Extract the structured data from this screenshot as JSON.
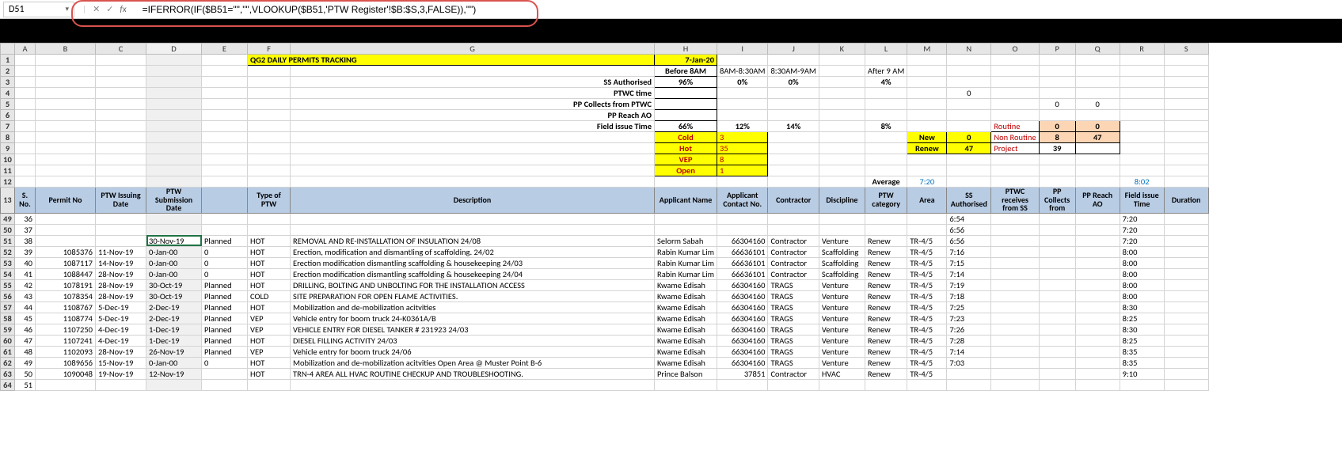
{
  "formulaBar": {
    "cellRef": "D51",
    "formula": "=IFERROR(IF($B51=\"\",\"\",VLOOKUP($B51,'PTW Register'!$B:$S,3,FALSE)),\"\")"
  },
  "top": {
    "title": "QG2 DAILY PERMITS TRACKING",
    "date": "7-Jan-20",
    "timeBuckets": [
      "Before 8AM",
      "8AM-8:30AM",
      "8:30AM-9AM",
      "After 9 AM"
    ],
    "rowLabels": [
      "SS Authorised",
      "PTWC time",
      "PP Collects from PTWC",
      "PP Reach AO",
      "Field issue Time"
    ],
    "ssAuth": [
      "96%",
      "0%",
      "0%",
      "4%"
    ],
    "ptwcCount": "0",
    "ppColl": [
      "0",
      "0"
    ],
    "fieldIssue": [
      "66%",
      "12%",
      "14%",
      "8%"
    ],
    "cats": [
      {
        "name": "Cold",
        "val": "3"
      },
      {
        "name": "Hot",
        "val": "35"
      },
      {
        "name": "VEP",
        "val": "8"
      },
      {
        "name": "Open",
        "val": "1"
      }
    ],
    "nr": [
      {
        "name": "New",
        "val": "0"
      },
      {
        "name": "Renew",
        "val": "47"
      }
    ],
    "statusLabels": [
      "Routine",
      "Non Routine",
      "Project"
    ],
    "statusVals": [
      [
        "0",
        "0"
      ],
      [
        "8",
        "47"
      ],
      [
        "39",
        ""
      ]
    ],
    "avgLabel": "Average",
    "avgVals": [
      "7:20",
      "8:02"
    ]
  },
  "headers": [
    "S. No.",
    "Permit No",
    "PTW Issuing Date",
    "PTW Submission Date",
    "",
    "Type of PTW",
    "Description",
    "Applicant Name",
    "Applicant Contact No.",
    "Contractor",
    "Discipline",
    "PTW category",
    "Area",
    "SS Authorised",
    "PTWC receives from SS",
    "PP Collects from",
    "PP Reach AO",
    "Field issue Time",
    "Duration"
  ],
  "rows": [
    {
      "r": "49",
      "sno": "36",
      "permit": "",
      "issue": "",
      "subm": "",
      "e": "",
      "type": "",
      "desc": "",
      "app": "",
      "appc": "",
      "contr": "",
      "disc": "",
      "cat": "",
      "area": "",
      "ss": "6:54",
      "o1": "",
      "o2": "",
      "o3": "",
      "fit": "7:20",
      "dur": ""
    },
    {
      "r": "50",
      "sno": "37",
      "permit": "",
      "issue": "",
      "subm": "",
      "e": "",
      "type": "",
      "desc": "",
      "app": "",
      "appc": "",
      "contr": "",
      "disc": "",
      "cat": "",
      "area": "",
      "ss": "6:56",
      "o1": "",
      "o2": "",
      "o3": "",
      "fit": "7:20",
      "dur": ""
    },
    {
      "r": "51",
      "sno": "38",
      "permit": "",
      "issue": "",
      "subm": "30-Nov-19",
      "e": "Planned",
      "type": "HOT",
      "desc": "REMOVAL AND RE-INSTALLATION OF INSULATION 24/08",
      "app": "Selorm Sabah",
      "appc": "66304160",
      "contr": "Contractor",
      "disc": "Venture",
      "cat": "Renew",
      "area": "TR-4/5",
      "ss": "6:56",
      "o1": "",
      "o2": "",
      "o3": "",
      "fit": "7:20",
      "dur": "",
      "sel": true
    },
    {
      "r": "52",
      "sno": "39",
      "permit": "1085376",
      "issue": "11-Nov-19",
      "subm": "0-Jan-00",
      "e": "0",
      "type": "HOT",
      "desc": "Erection, modification and dismantling of scaffolding. 24/02",
      "app": "Rabin Kumar Lim",
      "appc": "66636101",
      "contr": "Contractor",
      "disc": "Scaffolding",
      "cat": "Renew",
      "area": "TR-4/5",
      "ss": "7:16",
      "o1": "",
      "o2": "",
      "o3": "",
      "fit": "8:00",
      "dur": ""
    },
    {
      "r": "53",
      "sno": "40",
      "permit": "1087117",
      "issue": "14-Nov-19",
      "subm": "0-Jan-00",
      "e": "0",
      "type": "HOT",
      "desc": "Erection modification dismantling scaffolding & housekeeping 24/03",
      "app": "Rabin Kumar Lim",
      "appc": "66636101",
      "contr": "Contractor",
      "disc": "Scaffolding",
      "cat": "Renew",
      "area": "TR-4/5",
      "ss": "7:15",
      "o1": "",
      "o2": "",
      "o3": "",
      "fit": "8:00",
      "dur": ""
    },
    {
      "r": "54",
      "sno": "41",
      "permit": "1088447",
      "issue": "28-Nov-19",
      "subm": "0-Jan-00",
      "e": "0",
      "type": "HOT",
      "desc": "Erection modification dismantling scaffolding & housekeeping 24/04",
      "app": "Rabin Kumar Lim",
      "appc": "66636101",
      "contr": "Contractor",
      "disc": "Scaffolding",
      "cat": "Renew",
      "area": "TR-4/5",
      "ss": "7:14",
      "o1": "",
      "o2": "",
      "o3": "",
      "fit": "8:00",
      "dur": ""
    },
    {
      "r": "55",
      "sno": "42",
      "permit": "1078191",
      "issue": "28-Nov-19",
      "subm": "30-Oct-19",
      "e": "Planned",
      "type": "HOT",
      "desc": " DRILLING, BOLTING AND UNBOLTING FOR THE INSTALLATION ACCESS",
      "app": "Kwame Edisah",
      "appc": "66304160",
      "contr": "TRAGS",
      "disc": "Venture",
      "cat": "Renew",
      "area": "TR-4/5",
      "ss": "7:19",
      "o1": "",
      "o2": "",
      "o3": "",
      "fit": "8:00",
      "dur": ""
    },
    {
      "r": "56",
      "sno": "43",
      "permit": "1078354",
      "issue": "28-Nov-19",
      "subm": "30-Oct-19",
      "e": "Planned",
      "type": "COLD",
      "desc": "SITE PREPARATION FOR OPEN FLAME ACTIVITIES.",
      "app": "Kwame Edisah",
      "appc": "66304160",
      "contr": "TRAGS",
      "disc": "Venture",
      "cat": "Renew",
      "area": "TR-4/5",
      "ss": "7:18",
      "o1": "",
      "o2": "",
      "o3": "",
      "fit": "8:00",
      "dur": ""
    },
    {
      "r": "57",
      "sno": "44",
      "permit": "1108767",
      "issue": "5-Dec-19",
      "subm": "2-Dec-19",
      "e": "Planned",
      "type": "HOT",
      "desc": "Mobilization and de-mobilization acitvities",
      "app": "Kwame Edisah",
      "appc": "66304160",
      "contr": "TRAGS",
      "disc": "Venture",
      "cat": "Renew",
      "area": "TR-4/5",
      "ss": "7:25",
      "o1": "",
      "o2": "",
      "o3": "",
      "fit": "8:30",
      "dur": ""
    },
    {
      "r": "58",
      "sno": "45",
      "permit": "1108774",
      "issue": "5-Dec-19",
      "subm": "2-Dec-19",
      "e": "Planned",
      "type": "VEP",
      "desc": "Vehicle entry for boom truck 24-K0361A/B",
      "app": "Kwame Edisah",
      "appc": "66304160",
      "contr": "TRAGS",
      "disc": "Venture",
      "cat": "Renew",
      "area": "TR-4/5",
      "ss": "7:23",
      "o1": "",
      "o2": "",
      "o3": "",
      "fit": "8:25",
      "dur": ""
    },
    {
      "r": "59",
      "sno": "46",
      "permit": "1107250",
      "issue": "4-Dec-19",
      "subm": "1-Dec-19",
      "e": "Planned",
      "type": "VEP",
      "desc": "VEHICLE ENTRY FOR DIESEL TANKER # 231923 24/03",
      "app": "Kwame Edisah",
      "appc": "66304160",
      "contr": "TRAGS",
      "disc": "Venture",
      "cat": "Renew",
      "area": "TR-4/5",
      "ss": "7:26",
      "o1": "",
      "o2": "",
      "o3": "",
      "fit": "8:30",
      "dur": ""
    },
    {
      "r": "60",
      "sno": "47",
      "permit": "1107241",
      "issue": "4-Dec-19",
      "subm": "1-Dec-19",
      "e": "Planned",
      "type": "HOT",
      "desc": "DIESEL FILLING ACTIVITY 24/03",
      "app": "Kwame Edisah",
      "appc": "66304160",
      "contr": "TRAGS",
      "disc": "Venture",
      "cat": "Renew",
      "area": "TR-4/5",
      "ss": "7:28",
      "o1": "",
      "o2": "",
      "o3": "",
      "fit": "8:25",
      "dur": ""
    },
    {
      "r": "61",
      "sno": "48",
      "permit": "1102093",
      "issue": "28-Nov-19",
      "subm": "26-Nov-19",
      "e": "Planned",
      "type": "VEP",
      "desc": "Vehicle entry for boom truck 24/06",
      "app": "Kwame Edisah",
      "appc": "66304160",
      "contr": "TRAGS",
      "disc": "Venture",
      "cat": "Renew",
      "area": "TR-4/5",
      "ss": "7:14",
      "o1": "",
      "o2": "",
      "o3": "",
      "fit": "8:35",
      "dur": ""
    },
    {
      "r": "62",
      "sno": "49",
      "permit": "1089656",
      "issue": "15-Nov-19",
      "subm": "0-Jan-00",
      "e": "0",
      "type": "HOT",
      "desc": "Mobilization and de-mobilization acitvities Open Area @ Muster Point B-6",
      "app": "Kwame Edisah",
      "appc": "66304160",
      "contr": "TRAGS",
      "disc": "Venture",
      "cat": "Renew",
      "area": "TR-4/5",
      "ss": "7:03",
      "o1": "",
      "o2": "",
      "o3": "",
      "fit": "8:35",
      "dur": ""
    },
    {
      "r": "63",
      "sno": "50",
      "permit": "1090048",
      "issue": "19-Nov-19",
      "subm": "12-Nov-19",
      "e": "",
      "type": "HOT",
      "desc": "TRN-4 AREA ALL HVAC ROUTINE CHECKUP AND TROUBLESHOOTING.",
      "app": "Prince Balson",
      "appc": "37851",
      "contr": "Contractor",
      "disc": "HVAC",
      "cat": "Renew",
      "area": "TR-4/5",
      "ss": "",
      "o1": "",
      "o2": "",
      "o3": "",
      "fit": "9:10",
      "dur": ""
    },
    {
      "r": "64",
      "sno": "51",
      "permit": "",
      "issue": "",
      "subm": "",
      "e": "",
      "type": "",
      "desc": "",
      "app": "",
      "appc": "",
      "contr": "",
      "disc": "",
      "cat": "",
      "area": "",
      "ss": "",
      "o1": "",
      "o2": "",
      "o3": "",
      "fit": "",
      "dur": ""
    }
  ]
}
